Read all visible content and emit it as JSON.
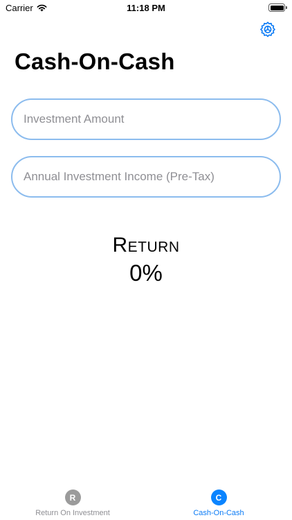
{
  "status_bar": {
    "carrier": "Carrier",
    "time": "11:18 PM",
    "wifi_icon": "wifi-icon",
    "battery_icon": "battery-full-icon"
  },
  "settings_icon": "gear-icon",
  "page_title": "Cash-On-Cash",
  "fields": {
    "investment_amount": {
      "placeholder": "Investment Amount",
      "value": ""
    },
    "annual_income": {
      "placeholder": "Annual Investment Income (Pre-Tax)",
      "value": ""
    }
  },
  "result": {
    "label": "Return",
    "value": "0%"
  },
  "tab_bar": {
    "tabs": [
      {
        "label": "Return On Investment",
        "icon_letter": "R",
        "selected": false
      },
      {
        "label": "Cash-On-Cash",
        "icon_letter": "C",
        "selected": true
      }
    ]
  },
  "colors": {
    "accent": "#0a84ff",
    "field_border": "#8cbcee",
    "inactive_tab": "#8e8e93"
  }
}
